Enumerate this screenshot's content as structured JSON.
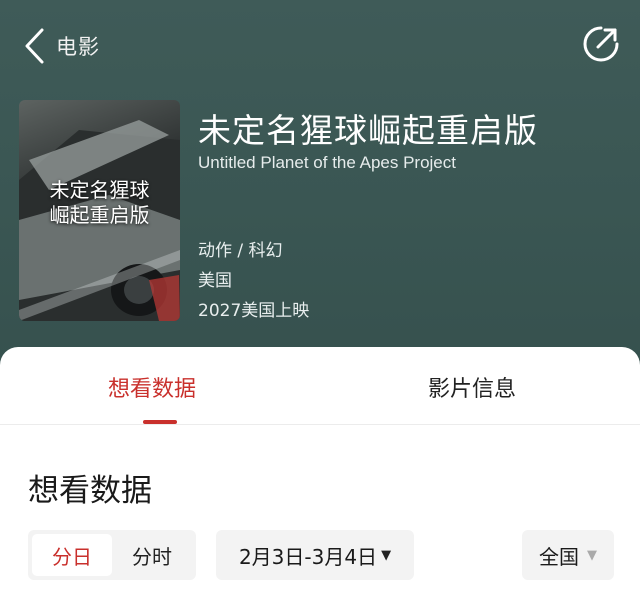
{
  "nav": {
    "title": "电影"
  },
  "movie": {
    "title_cn": "未定名猩球崛起重启版",
    "title_en": "Untitled Planet of the Apes Project",
    "poster_text_line1": "未定名猩球",
    "poster_text_line2": "崛起重启版",
    "genre": "动作 / 科幻",
    "country": "美国",
    "release": "2027美国上映"
  },
  "tabs": [
    {
      "label": "想看数据",
      "active": true
    },
    {
      "label": "影片信息",
      "active": false
    }
  ],
  "section": {
    "title": "想看数据"
  },
  "filters": {
    "granularity": [
      {
        "label": "分日",
        "active": true
      },
      {
        "label": "分时",
        "active": false
      }
    ],
    "date_range": "2月3日-3月4日",
    "region": "全国"
  },
  "colors": {
    "accent": "#c9302c",
    "hero_bg": "#3d5a57"
  },
  "icons": {
    "back": "chevron-left-icon",
    "share": "share-icon",
    "dropdown": "caret-down-icon"
  }
}
